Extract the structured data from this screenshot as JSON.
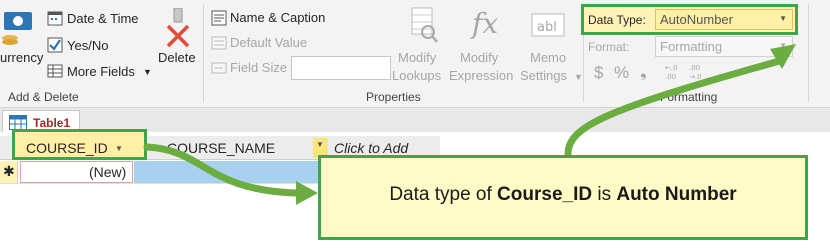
{
  "ribbon": {
    "add_delete": {
      "currency_label": "urrency",
      "date_time_label": "Date & Time",
      "yes_no_label": "Yes/No",
      "more_fields_label": "More Fields",
      "delete_label": "Delete",
      "group_label": "Add & Delete"
    },
    "properties": {
      "name_caption_label": "Name & Caption",
      "default_value_label": "Default Value",
      "field_size_label": "Field Size",
      "field_size_value": "",
      "modify_lookups_label_1": "Modify",
      "modify_lookups_label_2": "Lookups",
      "modify_expression_label_1": "Modify",
      "modify_expression_label_2": "Expression",
      "memo_settings_label_1": "Memo",
      "memo_settings_label_2": "Settings",
      "group_label": "Properties"
    },
    "formatting": {
      "data_type_label": "Data Type:",
      "data_type_value": "AutoNumber",
      "format_label": "Format:",
      "format_value": "Formatting",
      "currency_symbol": "$",
      "percent_symbol": "%",
      "comma_symbol": "❟",
      "group_label_partial": "Formatting"
    }
  },
  "tab": {
    "label": "Table1"
  },
  "grid": {
    "columns": [
      "COURSE_ID",
      "COURSE_NAME",
      "Click to Add"
    ],
    "new_row_marker": "✱",
    "new_row_value": "(New)"
  },
  "callout": {
    "part1": "Data type of ",
    "part2": "Course_ID",
    "part3": " is ",
    "part4": "Auto Number"
  },
  "colors": {
    "highlight_border": "#3ea54a",
    "highlight_fill": "#fff0a6",
    "arrow": "#6cad41",
    "selected_cell": "#a8d1f0",
    "header_selected": "#f7e679",
    "callout_fill": "#fffbc7"
  }
}
